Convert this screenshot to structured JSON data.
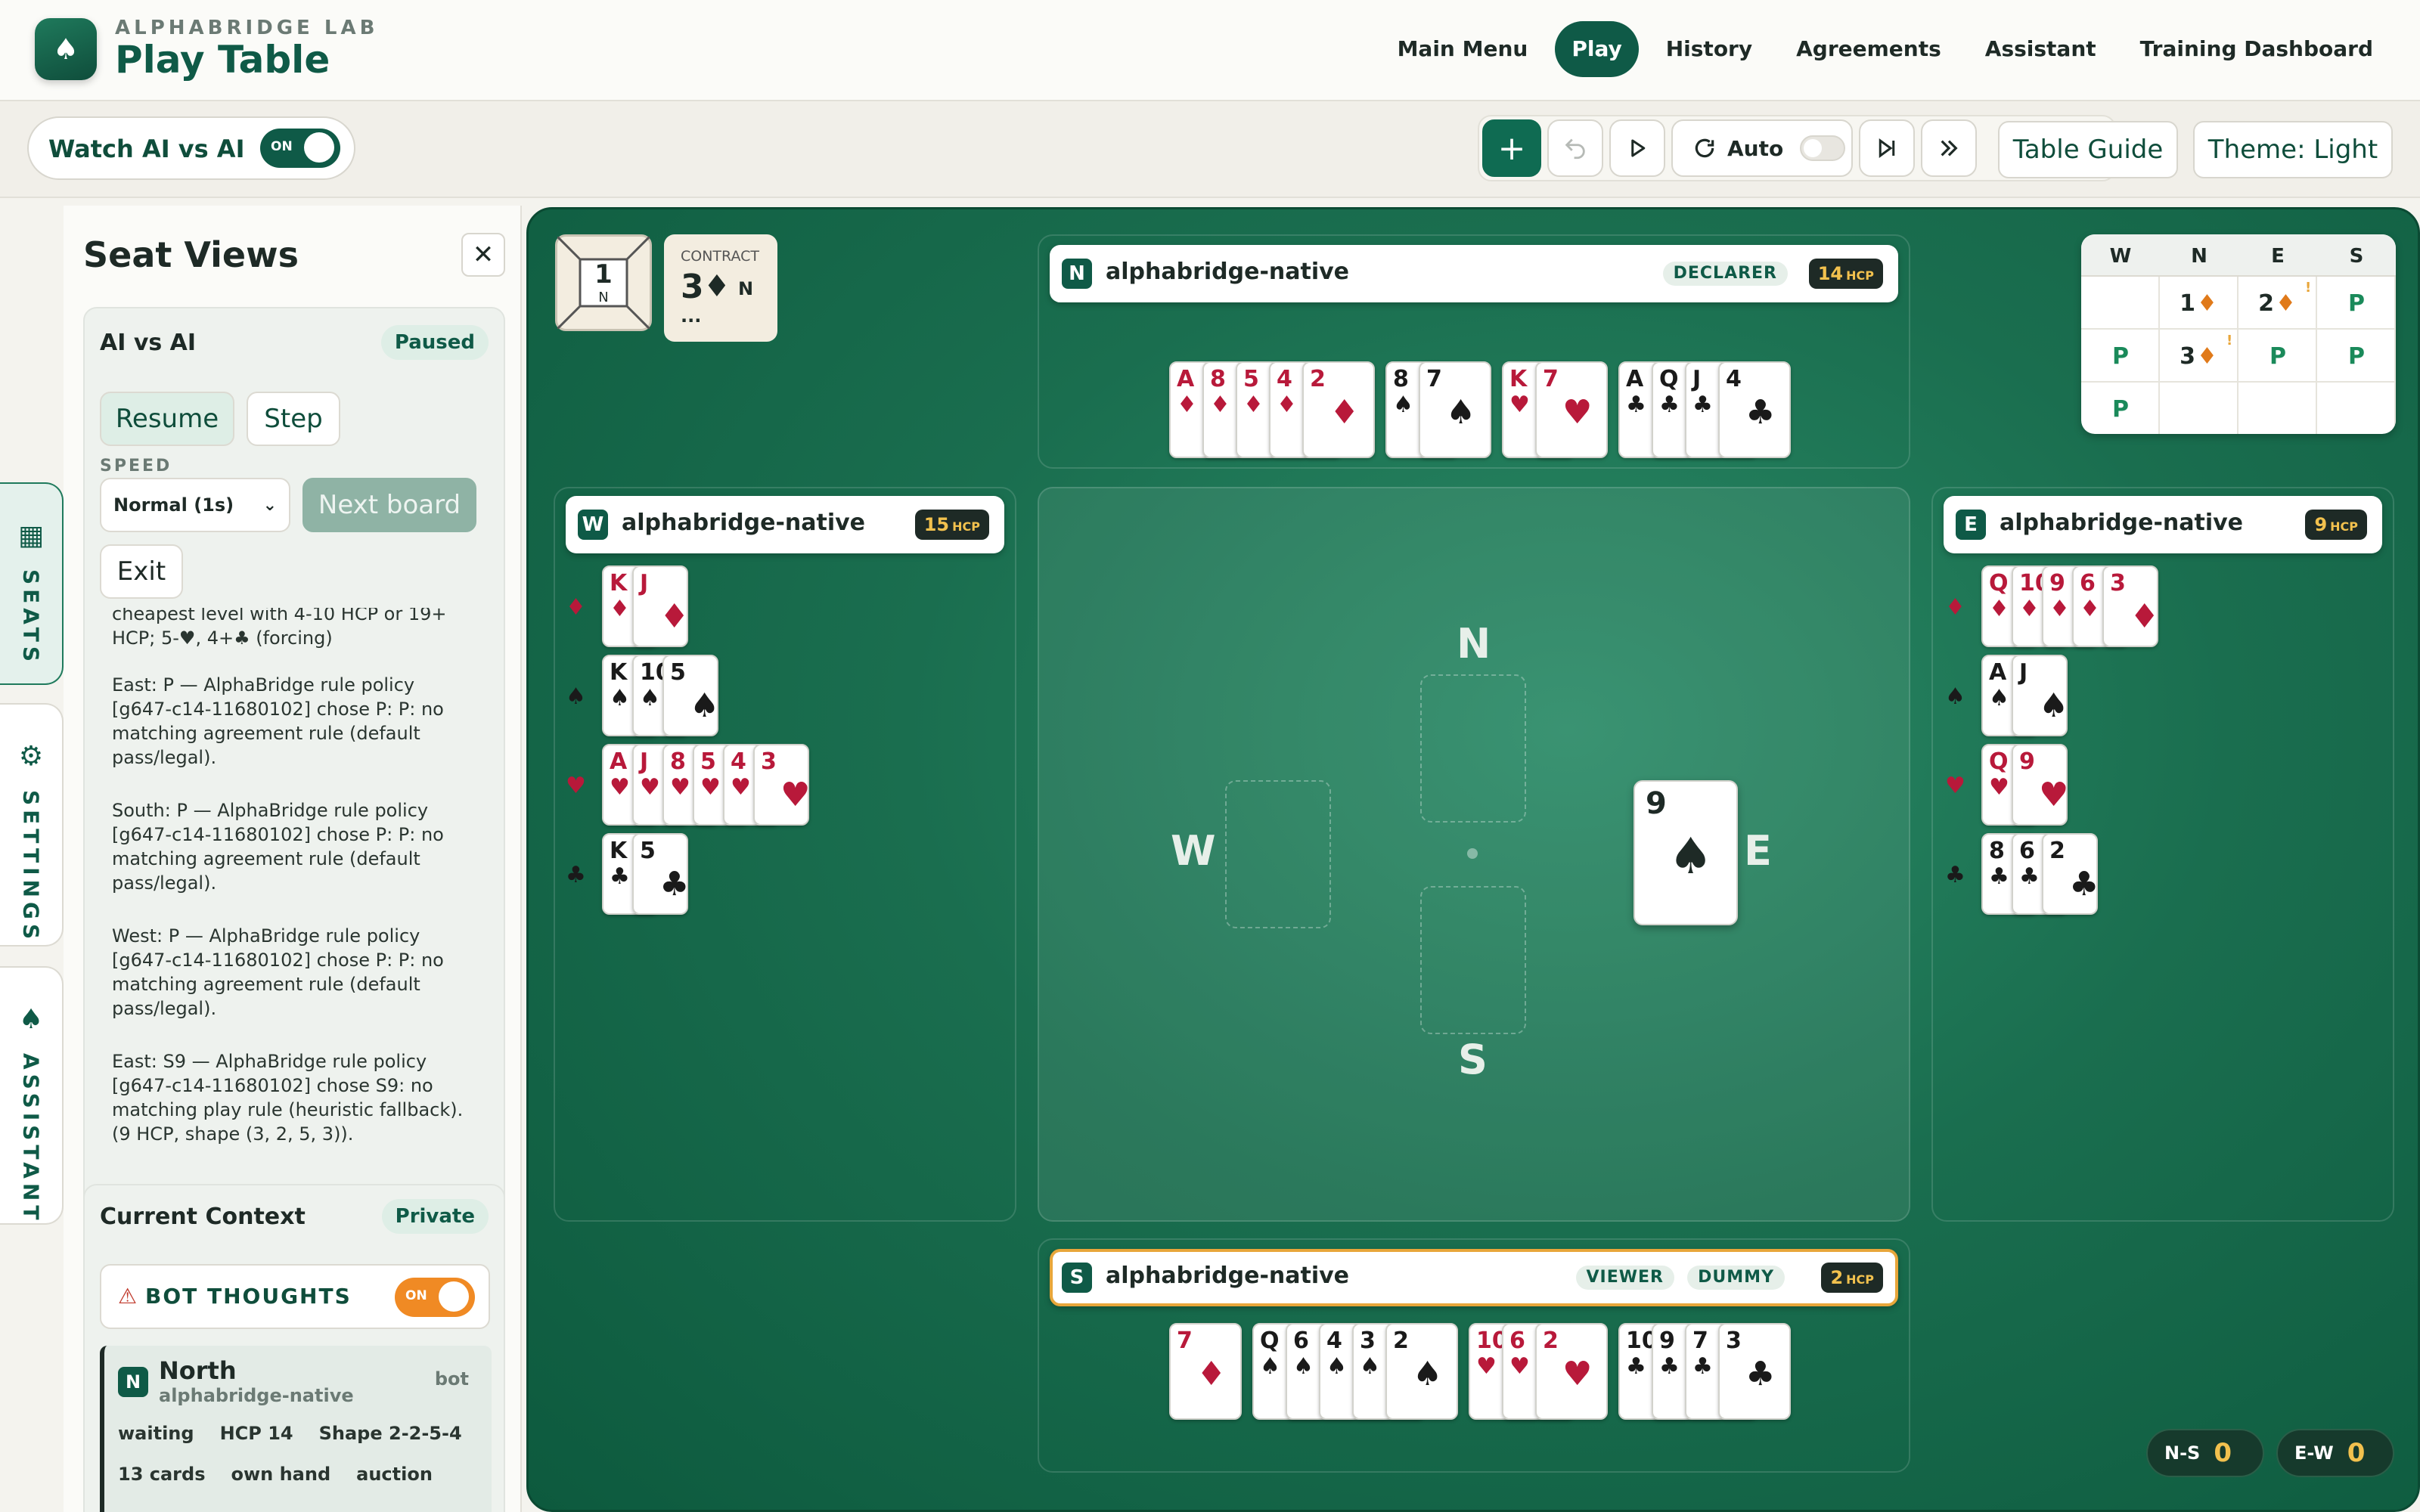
{
  "header": {
    "brand_sub": "ALPHABRIDGE LAB",
    "brand_title": "Play Table",
    "nav": [
      "Main Menu",
      "Play",
      "History",
      "Agreements",
      "Assistant",
      "Training Dashboard"
    ],
    "active_nav": "Play"
  },
  "toolbar": {
    "watch_label": "Watch AI vs AI",
    "watch_toggle": "ON",
    "auto_label": "Auto",
    "table_guide": "Table Guide",
    "theme": "Theme: Light"
  },
  "rail": [
    "SEATS",
    "SETTINGS",
    "ASSISTANT"
  ],
  "panel": {
    "title": "Seat Views",
    "ai_card": {
      "title": "AI vs AI",
      "status": "Paused",
      "resume": "Resume",
      "step": "Step",
      "speed_label": "SPEED",
      "speed_value": "Normal (1s)",
      "next_board": "Next board",
      "exit": "Exit"
    },
    "log": [
      "cheapest level with 4-10 HCP or 19+ HCP; 5-♥, 4+♣ (forcing)",
      "East: P — AlphaBridge rule policy [g647-c14-11680102] chose P: P: no matching agreement rule (default pass/legal).",
      "South: P — AlphaBridge rule policy [g647-c14-11680102] chose P: P: no matching agreement rule (default pass/legal).",
      "West: P — AlphaBridge rule policy [g647-c14-11680102] chose P: P: no matching agreement rule (default pass/legal).",
      "East: S9 — AlphaBridge rule policy [g647-c14-11680102] chose S9: no matching play rule (heuristic fallback). (9 HCP, shape (3, 2, 5, 3))."
    ],
    "context": {
      "title": "Current Context",
      "badge": "Private",
      "bot_thoughts": "BOT THOUGHTS",
      "bot_toggle": "ON",
      "seat_letter": "N",
      "seat_name": "North",
      "seat_player": "alphabridge-native",
      "seat_type": "bot",
      "chips_row1": [
        "waiting",
        "HCP 14",
        "Shape 2-2-5-4"
      ],
      "chips_row2": [
        "13 cards",
        "own hand",
        "auction"
      ]
    }
  },
  "table": {
    "board_number": "1",
    "board_dealer": "N",
    "contract_label": "CONTRACT",
    "contract_level": "3",
    "contract_suit": "♦",
    "contract_declarer": "N",
    "contract_more": "...",
    "seats": {
      "north": {
        "letter": "N",
        "name": "alphabridge-native",
        "roles": [
          "DECLARER"
        ],
        "hcp": "14",
        "hcp_unit": "HCP"
      },
      "west": {
        "letter": "W",
        "name": "alphabridge-native",
        "hcp": "15",
        "hcp_unit": "HCP"
      },
      "east": {
        "letter": "E",
        "name": "alphabridge-native",
        "hcp": "9",
        "hcp_unit": "HCP"
      },
      "south": {
        "letter": "S",
        "name": "alphabridge-native",
        "roles": [
          "VIEWER",
          "DUMMY"
        ],
        "hcp": "2",
        "hcp_unit": "HCP"
      }
    },
    "hands": {
      "north": [
        {
          "suit": "♦",
          "color": "red",
          "cards": [
            "A",
            "8",
            "5",
            "4",
            "2"
          ]
        },
        {
          "suit": "♠",
          "color": "black",
          "cards": [
            "8",
            "7"
          ]
        },
        {
          "suit": "♥",
          "color": "red",
          "cards": [
            "K",
            "7"
          ]
        },
        {
          "suit": "♣",
          "color": "black",
          "cards": [
            "A",
            "Q",
            "J",
            "4"
          ]
        }
      ],
      "south": [
        {
          "suit": "♦",
          "color": "red",
          "cards": [
            "7"
          ]
        },
        {
          "suit": "♠",
          "color": "black",
          "cards": [
            "Q",
            "6",
            "4",
            "3",
            "2"
          ]
        },
        {
          "suit": "♥",
          "color": "red",
          "cards": [
            "10",
            "6",
            "2"
          ]
        },
        {
          "suit": "♣",
          "color": "black",
          "cards": [
            "10",
            "9",
            "7",
            "3"
          ]
        }
      ],
      "west": [
        {
          "suit": "♦",
          "color": "red",
          "cards": [
            "K",
            "J"
          ]
        },
        {
          "suit": "♠",
          "color": "black",
          "cards": [
            "K",
            "10",
            "5"
          ]
        },
        {
          "suit": "♥",
          "color": "red",
          "cards": [
            "A",
            "J",
            "8",
            "5",
            "4",
            "3"
          ]
        },
        {
          "suit": "♣",
          "color": "black",
          "cards": [
            "K",
            "5"
          ]
        }
      ],
      "east": [
        {
          "suit": "♦",
          "color": "red",
          "cards": [
            "Q",
            "10",
            "9",
            "6",
            "3"
          ]
        },
        {
          "suit": "♠",
          "color": "black",
          "cards": [
            "A",
            "J"
          ]
        },
        {
          "suit": "♥",
          "color": "red",
          "cards": [
            "Q",
            "9"
          ]
        },
        {
          "suit": "♣",
          "color": "black",
          "cards": [
            "8",
            "6",
            "2"
          ]
        }
      ]
    },
    "center_labels": {
      "n": "N",
      "s": "S",
      "w": "W",
      "e": "E"
    },
    "played_card": {
      "rank": "9",
      "suit": "♠"
    },
    "auction": {
      "headers": [
        "W",
        "N",
        "E",
        "S"
      ],
      "rows": [
        [
          "",
          "1♦",
          "2♦",
          "P"
        ],
        [
          "P",
          "3♦",
          "P",
          "P"
        ],
        [
          "P",
          "",
          "",
          ""
        ]
      ],
      "alerts": [
        "!",
        "!"
      ]
    },
    "score": {
      "ns_label": "N-S",
      "ns": "0",
      "ew_label": "E-W",
      "ew": "0"
    }
  },
  "colors": {
    "brand": "#0f5a47",
    "felt": "#1a6e4f",
    "red_suit": "#b8193a",
    "accent_orange": "#f08a24"
  }
}
